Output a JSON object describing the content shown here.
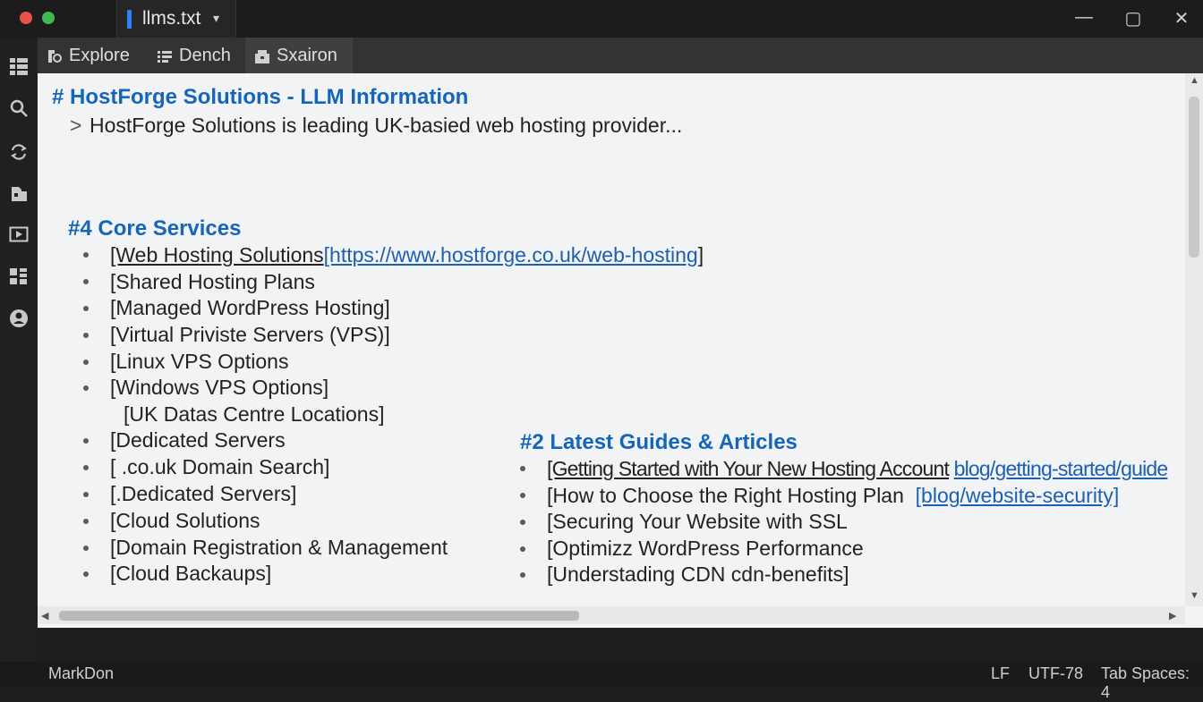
{
  "window": {
    "tab_name": "llms.txt",
    "tab_caret": "▾",
    "minimize": "—",
    "maximize": "▢",
    "close": "✕"
  },
  "activity_bar": [
    "grid-icon",
    "search-icon",
    "sync-icon",
    "extensions-icon",
    "run-icon",
    "blocks-icon",
    "account-icon"
  ],
  "tabs": [
    {
      "label": "Explore",
      "icon": "explore-icon",
      "active": false
    },
    {
      "label": "Dench",
      "icon": "list-icon",
      "active": false
    },
    {
      "label": "Sxairon",
      "icon": "box-icon",
      "active": true
    }
  ],
  "doc": {
    "title": "# HostForge Solutions - LLM Information",
    "quote_mark": ">",
    "quote": "HostForge Solutions is leading UK-basied web hosting provider...",
    "core_heading": "#4 Core Services",
    "core": [
      {
        "text": "[Web Hosting Solutions",
        "link": "[https://www.hostforge.co.uk/web-hosting",
        "end": "]"
      },
      {
        "text": "[Shared Hosting Plans"
      },
      {
        "text": "[Managed WordPress Hosting]"
      },
      {
        "text": "[Virtual Priviste Servers (VPS)]"
      },
      {
        "text": "[Linux VPS Options"
      },
      {
        "text": "[Windows VPS Options]"
      },
      {
        "text": "[UK Datas Centre Locations]",
        "nobullet": true
      },
      {
        "text": "[Dedicated Servers"
      },
      {
        "text": "[ .co.uk Domain Search]"
      },
      {
        "text": "[.Dedicated Servers]"
      },
      {
        "text": "[Cloud Solutions"
      },
      {
        "text": "[Domain Registration & Management"
      },
      {
        "text": "[Cloud Backaups]"
      }
    ],
    "guides_heading": "#2 Latest Guides & Articles",
    "guides": [
      {
        "text": "[Getting Started with Your New Hosting Account",
        "link": "blog/getting-started/guide"
      },
      {
        "text": "[How to Choose the Right Hosting Plan",
        "link": "[blog/website-security]"
      },
      {
        "text": "[Securing Your Website with SSL"
      },
      {
        "text": "[Optimizz WordPress Performance"
      },
      {
        "text": "[Understading CDN cdn-benefits]"
      }
    ]
  },
  "status": {
    "mode": "MarkDon",
    "eol": "LF",
    "encoding": "UTF-78",
    "indent": "Tab Spaces: 4"
  },
  "colors": {
    "heading": "#1565b8",
    "link": "#1d5fb0",
    "accent": "#2f81f7"
  }
}
